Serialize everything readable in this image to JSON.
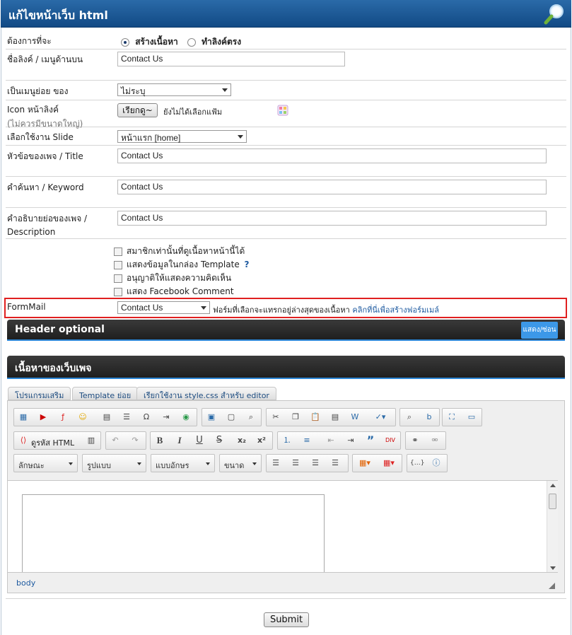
{
  "header": {
    "title": "แก้ไขหน้าเว็บ html",
    "icon": "magnifier-icon"
  },
  "form": {
    "want_label": "ต้องการที่จะ",
    "radio_create": "สร้างเนื้อหา",
    "radio_link": "ทำลิงค์ตรง",
    "link_name_label": "ชื่อลิงค์ / เมนูด้านบน",
    "link_name_value": "Contact Us",
    "submenu_label": "เป็นเมนูย่อย ของ",
    "submenu_value": "ไม่ระบุ",
    "icon_label": "Icon หน้าลิงค์",
    "icon_sublabel": "(ไม่ควรมีขนาดใหญ่)",
    "browse_button": "เรียกดู~",
    "no_file_text": "ยังไม่ได้เลือกแฟ้ม",
    "slide_label": "เลือกใช้งาน Slide",
    "slide_value": "หน้าแรก [home]",
    "title_label": "หัวข้อของเพจ / Title",
    "title_value": "Contact Us",
    "keyword_label": "คำค้นหา / Keyword",
    "keyword_value": "Contact Us",
    "desc_label": "คำอธิบายย่อของเพจ /",
    "desc_label2": "Description",
    "desc_value": "Contact Us",
    "checkboxes": [
      "สมาชิกเท่านั้นที่ดูเนื้อหาหน้านี้ได้",
      "แสดงข้อมูลในกล่อง Template",
      "อนุญาติให้แสดงความคิดเห็น",
      "แสดง Facebook Comment"
    ],
    "help_mark": "?",
    "formmail_label": "FormMail",
    "formmail_value": "Contact Us",
    "formmail_note": "ฟอร์มที่เลือกจะแทรกอยู่ล่างสุดของเนื้อหา",
    "formmail_link": "คลิกที่นี่เพื่อสร้างฟอร์มเมล์"
  },
  "header_optional": {
    "title": "Header optional",
    "toggle": "แสดง/ซ่อน"
  },
  "content_section": {
    "title": "เนื้อหาของเว็บเพจ"
  },
  "editor_tabs": [
    "โปรแกรมเสริม",
    "Template ย่อย",
    "เรียกใช้งาน style.css สำหรับ editor"
  ],
  "toolbar": {
    "source_html": "ดูรหัส HTML",
    "bold": "B",
    "italic": "I",
    "underline": "U",
    "strike": "S",
    "subscript": "x₂",
    "superscript": "x²",
    "style_select": "ลักษณะ",
    "format_select": "รูปแบบ",
    "font_select": "แบบอักษร",
    "size_select": "ขนาด"
  },
  "editor_status": "body",
  "submit_label": "Submit",
  "colors": {
    "header_blue": "#1a5490",
    "formmail_border": "#e02020",
    "accent_blue": "#3c98e8",
    "link": "#1d5aa0"
  }
}
